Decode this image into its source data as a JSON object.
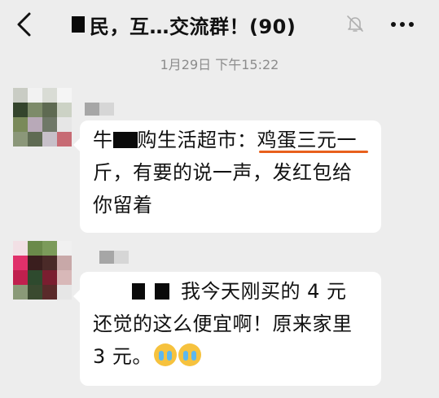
{
  "header": {
    "title": "民，互…交流群！(90)",
    "back_icon": "chevron-left-icon",
    "mute_icon": "bell-off-icon",
    "more_icon": "more-dots-icon"
  },
  "timestamp": "1月29日 下午15:22",
  "messages": [
    {
      "line1_prefix": "牛",
      "line1_mid": "购生活超市：",
      "line1_highlight": "鸡蛋三元一",
      "line2": "斤，有要的说一声，发红包给",
      "line3": "你留着",
      "highlight_color": "#e8601c"
    },
    {
      "line1_tail": "我今天刚买的 4 元",
      "line2": "还觉的这么便宜啊！原来家里",
      "line3": "3 元。",
      "emoji": "crying-emoji",
      "emoji_count": 2
    }
  ]
}
